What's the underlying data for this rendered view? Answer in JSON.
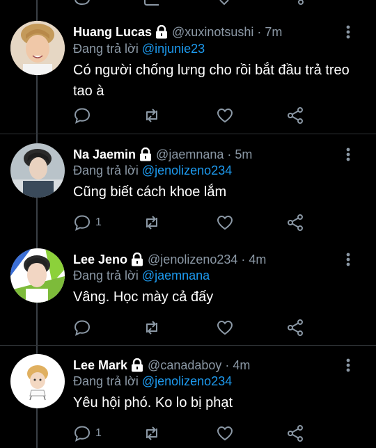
{
  "tweets": [
    {
      "name": "Huang Lucas",
      "handle": "@xuxinotsushi",
      "time": "7m",
      "reply_prefix": "Đang trả lời",
      "reply_to": "@injunie23",
      "text": "Có người chống lưng cho rồi bắt đầu trả treo tao à",
      "reply_count": "",
      "avatar_bg": "#d9c7b4"
    },
    {
      "name": "Na Jaemin",
      "handle": "@jaemnana",
      "time": "5m",
      "reply_prefix": "Đang trả lời",
      "reply_to": "@jenolizeno234",
      "text": "Cũng biết cách khoe lắm",
      "reply_count": "1",
      "avatar_bg": "#b9c3c9"
    },
    {
      "name": "Lee Jeno",
      "handle": "@jenolizeno234",
      "time": "4m",
      "reply_prefix": "Đang trả lời",
      "reply_to": "@jaemnana",
      "text": "Vâng. Học mày cả đấy",
      "reply_count": "",
      "avatar_bg": "#7dbb3a"
    },
    {
      "name": "Lee Mark",
      "handle": "@canadaboy",
      "time": "4m",
      "reply_prefix": "Đang trả lời",
      "reply_to": "@jenolizeno234",
      "text": "Yêu hội phó. Ko lo bị phạt",
      "reply_count": "1",
      "avatar_bg": "#ffffff"
    }
  ],
  "colors": {
    "background": "#000000",
    "text": "#ffffff",
    "muted": "#8b98a5",
    "link": "#1d9bf0",
    "divider": "#2f3336"
  },
  "icons": [
    "lock-icon",
    "more-icon",
    "reply-icon",
    "retweet-icon",
    "like-icon",
    "share-icon"
  ]
}
